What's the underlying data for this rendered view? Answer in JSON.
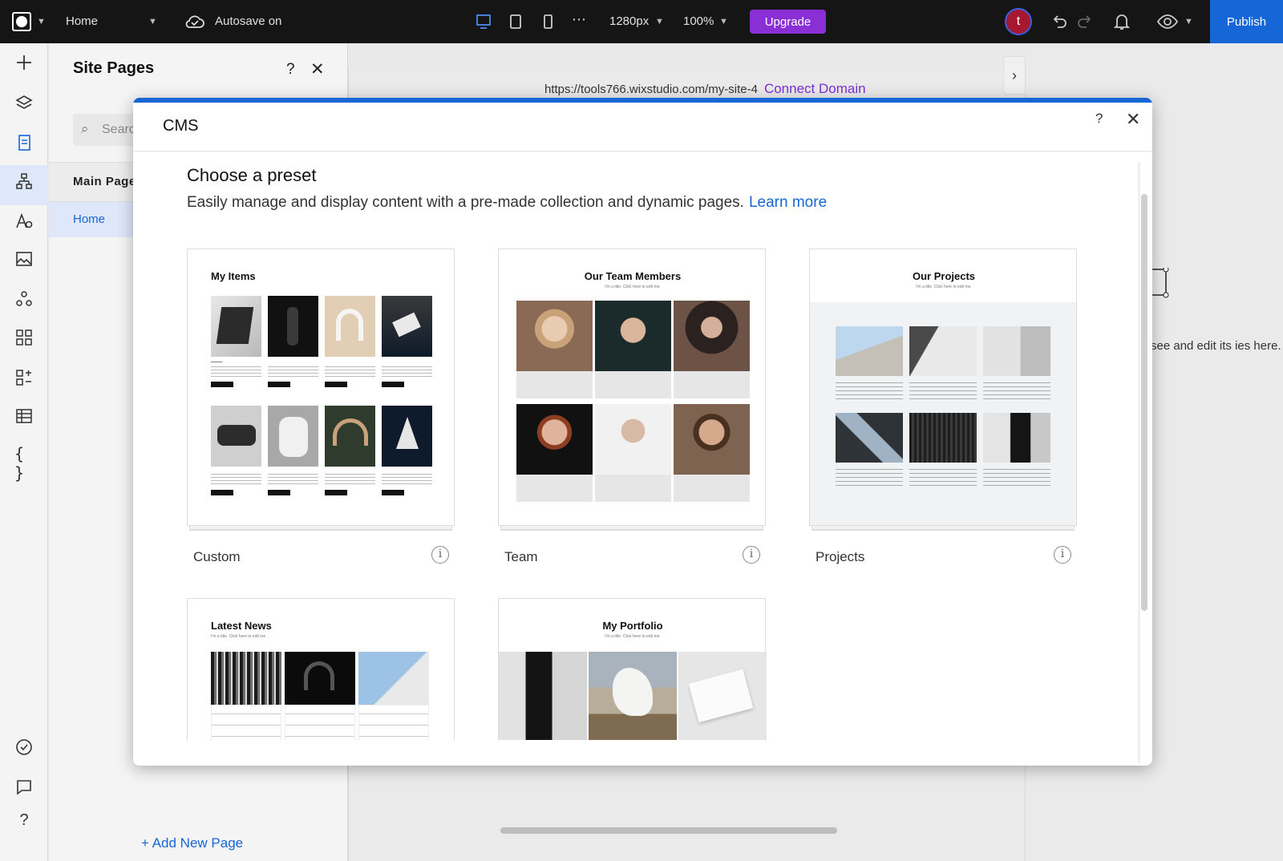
{
  "topbar": {
    "page_select": "Home",
    "autosave": "Autosave on",
    "width_value": "1280px",
    "zoom_value": "100%",
    "upgrade_label": "Upgrade",
    "avatar_letter": "t",
    "publish_label": "Publish"
  },
  "site_panel": {
    "title": "Site Pages",
    "help": "?",
    "close": "✕",
    "search_placeholder": "Search",
    "main_pages": "Main Pages",
    "home_item": "Home",
    "add_page": "+ Add New Page"
  },
  "canvas": {
    "url": "https://tools766.wixstudio.com/my-site-4",
    "connect_domain": "Connect Domain",
    "hint_text": "t to see and edit its ies here."
  },
  "modal": {
    "title": "CMS",
    "help": "?",
    "close": "✕",
    "heading": "Choose a preset",
    "subtitle": "Easily manage and display content with a pre-made collection and dynamic pages.",
    "learn_more": "Learn more",
    "info_glyph": "i",
    "presets": [
      {
        "label": "Custom",
        "preview_title": "My Items",
        "preview_sub": ""
      },
      {
        "label": "Team",
        "preview_title": "Our Team Members",
        "preview_sub": "I'm a title. Click here to edit me."
      },
      {
        "label": "Projects",
        "preview_title": "Our Projects",
        "preview_sub": "I'm a title. Click here to edit me."
      },
      {
        "label": "",
        "preview_title": "Latest News",
        "preview_sub": "I'm a title. Click here to edit me."
      },
      {
        "label": "",
        "preview_title": "My Portfolio",
        "preview_sub": "I'm a title. Click here to edit me."
      }
    ]
  },
  "colors": {
    "topbar_bg": "#151515",
    "accent_blue": "#1666d8",
    "upgrade_purple": "#8a2fd6",
    "avatar_red": "#a6182f"
  }
}
